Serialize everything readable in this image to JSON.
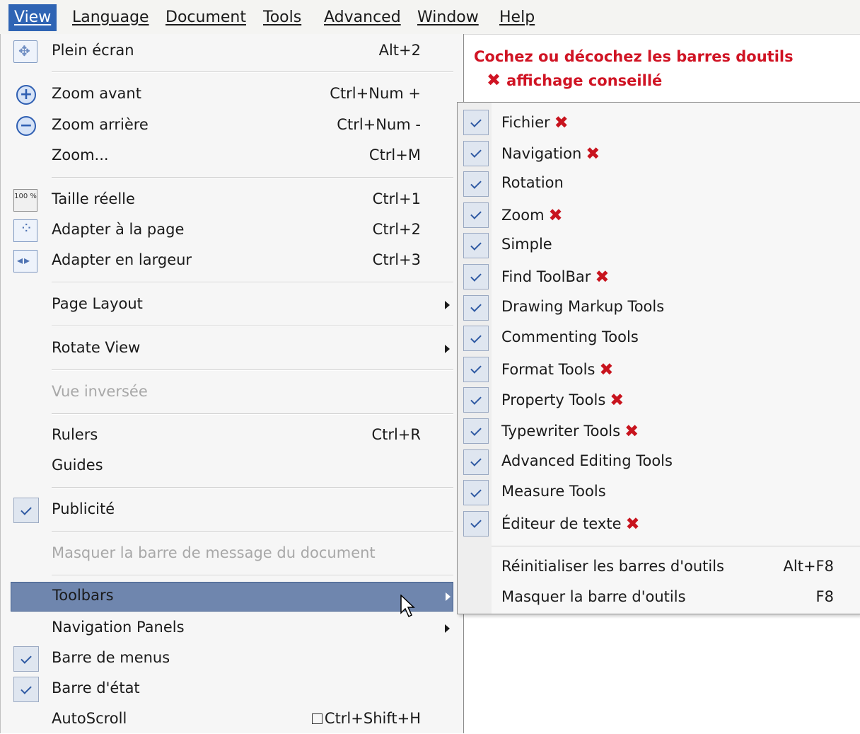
{
  "menubar": {
    "items": [
      {
        "label": "View"
      },
      {
        "label": "Language"
      },
      {
        "label": "Document"
      },
      {
        "label": "Tools"
      },
      {
        "label": "Advanced"
      },
      {
        "label": "Window"
      },
      {
        "label": "Help"
      }
    ]
  },
  "view_menu": {
    "plein_ecran": {
      "label": "Plein écran",
      "shortcut": "Alt+2",
      "icon": "fullscreen-icon"
    },
    "zoom_avant": {
      "label": "Zoom avant",
      "shortcut": "Ctrl+Num +",
      "icon": "zoom-in-icon"
    },
    "zoom_arriere": {
      "label": "Zoom arrière",
      "shortcut": "Ctrl+Num -",
      "icon": "zoom-out-icon"
    },
    "zoom": {
      "label": "Zoom...",
      "shortcut": "Ctrl+M"
    },
    "taille_reelle": {
      "label": "Taille réelle",
      "shortcut": "Ctrl+1",
      "icon": "actual-size-icon",
      "icon_text": "100 %"
    },
    "adapter_page": {
      "label": "Adapter à la page",
      "shortcut": "Ctrl+2",
      "icon": "fit-page-icon"
    },
    "adapter_largeur": {
      "label": "Adapter en largeur",
      "shortcut": "Ctrl+3",
      "icon": "fit-width-icon"
    },
    "page_layout": {
      "label": "Page Layout"
    },
    "rotate_view": {
      "label": "Rotate View"
    },
    "vue_inversee": {
      "label": "Vue inversée",
      "disabled": true
    },
    "rulers": {
      "label": "Rulers",
      "shortcut": "Ctrl+R"
    },
    "guides": {
      "label": "Guides"
    },
    "publicite": {
      "label": "Publicité",
      "checked": true
    },
    "masquer_message": {
      "label": "Masquer la barre de message du document",
      "disabled": true
    },
    "toolbars": {
      "label": "Toolbars",
      "highlighted": true
    },
    "navigation_panels": {
      "label": "Navigation Panels"
    },
    "barre_menus": {
      "label": "Barre de menus",
      "checked": true
    },
    "barre_etat": {
      "label": "Barre d'état",
      "checked": true
    },
    "autoscroll": {
      "label": "AutoScroll",
      "shortcut": "Ctrl+Shift+H"
    }
  },
  "toolbars_submenu": {
    "items": [
      {
        "label": "Fichier",
        "checked": true,
        "marked": true
      },
      {
        "label": "Navigation",
        "checked": true,
        "marked": true
      },
      {
        "label": "Rotation",
        "checked": true,
        "marked": false
      },
      {
        "label": "Zoom",
        "checked": true,
        "marked": true
      },
      {
        "label": "Simple",
        "checked": true,
        "marked": false
      },
      {
        "label": "Find ToolBar",
        "checked": true,
        "marked": true
      },
      {
        "label": "Drawing Markup Tools",
        "checked": true,
        "marked": false
      },
      {
        "label": "Commenting Tools",
        "checked": true,
        "marked": false
      },
      {
        "label": "Format Tools",
        "checked": true,
        "marked": true
      },
      {
        "label": "Property Tools",
        "checked": true,
        "marked": true
      },
      {
        "label": "Typewriter Tools",
        "checked": true,
        "marked": true
      },
      {
        "label": "Advanced Editing Tools",
        "checked": true,
        "marked": false
      },
      {
        "label": "Measure Tools",
        "checked": true,
        "marked": false
      },
      {
        "label": "Éditeur de texte",
        "checked": true,
        "marked": true
      }
    ],
    "reset": {
      "label": "Réinitialiser les barres d'outils",
      "shortcut": "Alt+F8"
    },
    "hide": {
      "label": "Masquer la barre d'outils",
      "shortcut": "F8"
    }
  },
  "annotation": {
    "line1": "Cochez ou décochez les barres doutils",
    "line2": "affichage conseillé",
    "mark_icon": "red-x-mark-icon"
  },
  "colors": {
    "accent": "#2f64b4",
    "highlight": "#6f86ae",
    "annotation_red": "#d01424"
  }
}
